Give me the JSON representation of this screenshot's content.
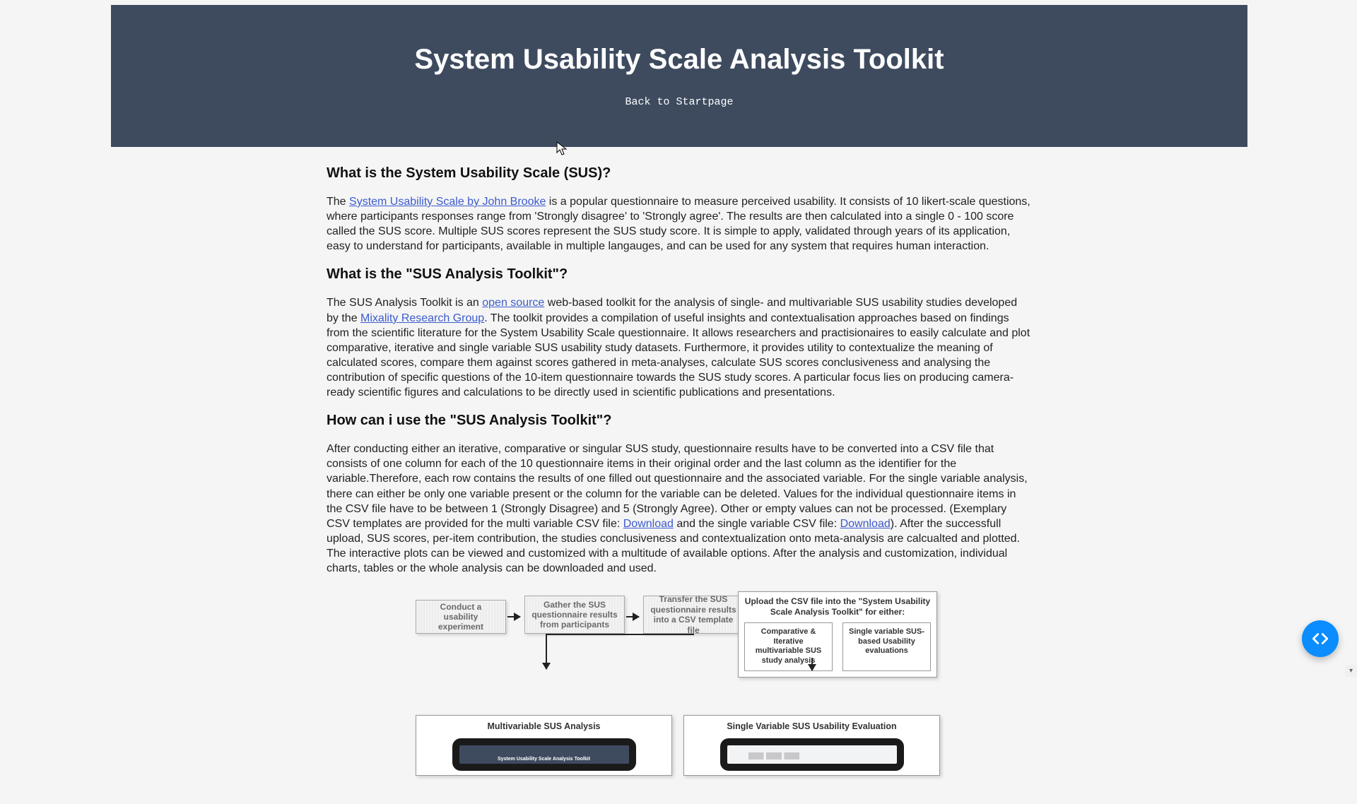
{
  "header": {
    "title": "System Usability Scale Analysis Toolkit",
    "back_link": "Back to Startpage"
  },
  "sections": {
    "what_is_sus": {
      "heading": "What is the System Usability Scale (SUS)?",
      "p1_pre": "The ",
      "p1_link": "System Usability Scale by John Brooke",
      "p1_post": " is a popular questionnaire to measure perceived usability. It consists of 10 likert-scale questions, where participants responses range from 'Strongly disagree' to 'Strongly agree'. The results are then calculated into a single 0 - 100 score called the SUS score. Multiple SUS scores represent the SUS study score. It is simple to apply, validated through years of its application, easy to understand for participants, available in multiple langauges, and can be used for any system that requires human interaction."
    },
    "what_is_toolkit": {
      "heading": "What is the \"SUS Analysis Toolkit\"?",
      "p1_a": "The SUS Analysis Toolkit is an ",
      "p1_link1": "open source",
      "p1_b": " web-based toolkit for the analysis of single- and multivariable SUS usability studies developed by the ",
      "p1_link2": "Mixality Research Group",
      "p1_c": ". The toolkit provides a compilation of useful insights and contextualisation approaches based on findings from the scientific literature for the System Usability Scale questionnaire. It allows researchers and practisionaires to easily calculate and plot comparative, iterative and single variable SUS usability study datasets. Furthermore, it provides utility to contextualize the meaning of calculated scores, compare them against scores gathered in meta-analyses, calculate SUS scores conclusiveness and analysing the contribution of specific questions of the 10-item questionnaire towards the SUS study scores. A particular focus lies on producing camera-ready scientific figures and calculations to be directly used in scientific publications and presentations."
    },
    "how_use": {
      "heading": "How can i use the \"SUS Analysis Toolkit\"?",
      "p1_a": "After conducting either an iterative, comparative or singular SUS study, questionnaire results have to be converted into a CSV file that consists of one column for each of the 10 questionnaire items in their original order and the last column as the identifier for the variable.Therefore, each row contains the results of one filled out questionnaire and the associated variable. For the single variable analysis, there can either be only one variable present or the column for the variable can be deleted. Values for the individual questionnaire items in the CSV file have to be between 1 (Strongly Disagree) and 5 (Strongly Agree). Other or empty values can not be processed. (Exemplary CSV templates are provided for the multi variable CSV file: ",
      "p1_link1": "Download",
      "p1_b": " and the single variable CSV file: ",
      "p1_link2": "Download",
      "p1_c": "). After the successfull upload, SUS scores, per-item contribution, the studies conclusiveness and contextualization onto meta-analysis are calcualted and plotted. The interactive plots can be viewed and customized with a multitude of available options. After the analysis and customization, individual charts, tables or the whole analysis can be downloaded and used."
    }
  },
  "diagram": {
    "step1": "Conduct a usability experiment",
    "step2": "Gather the SUS questionnaire results from participants",
    "step3": "Transfer the SUS questionnaire results into a CSV template file",
    "upload_heading": "Upload the CSV file into the \"System Usability Scale Analysis Toolkit\" for either:",
    "upload_sub1": "Comparative & Iterative multivariable SUS study analysis",
    "upload_sub2": "Single variable SUS-based Usability evaluations",
    "panel1_title": "Multivariable SUS Analysis",
    "panel2_title": "Single Variable SUS Usability Evaluation",
    "mini_app_caption": "System Usability Scale Analysis Toolkit"
  },
  "fab": {
    "label": "code"
  }
}
